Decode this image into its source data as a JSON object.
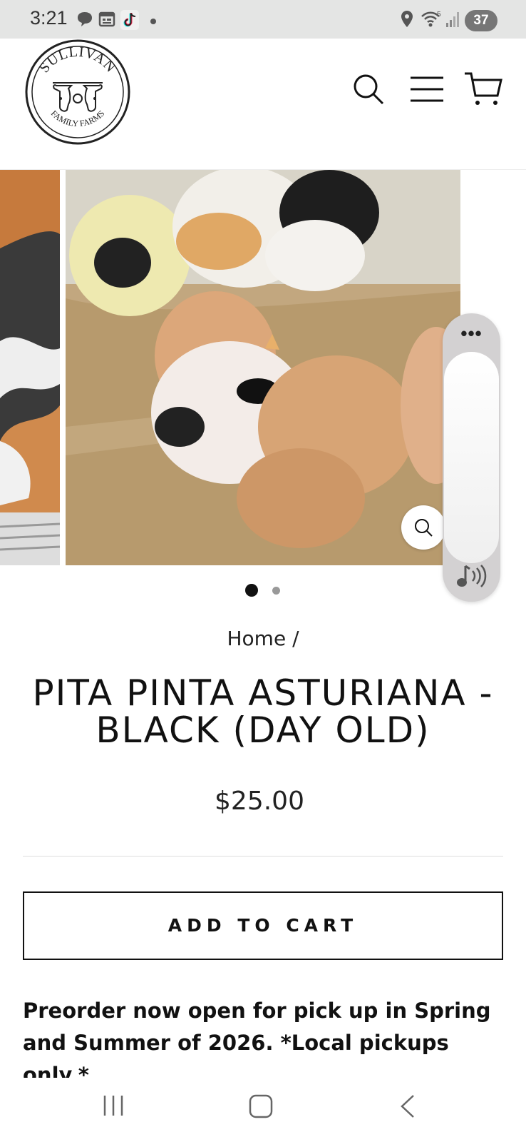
{
  "status_bar": {
    "time": "3:21",
    "battery": "37",
    "network": "5",
    "icons": [
      "chat-icon",
      "calendar-icon",
      "tiktok-icon",
      "dot-icon",
      "location-icon",
      "wifi-icon",
      "signal-icon"
    ]
  },
  "header": {
    "logo_text": "SULLIVAN",
    "logo_subtext": "FAMILY FARMS",
    "icons": [
      "search-icon",
      "menu-icon",
      "cart-icon"
    ]
  },
  "gallery": {
    "current_index": 1,
    "total": 2
  },
  "side_panel": {
    "more": "•••",
    "icons": [
      "more-icon",
      "sound-icon"
    ]
  },
  "product": {
    "breadcrumb": "Home /",
    "title": "PITA PINTA ASTURIANA - BLACK (DAY OLD)",
    "price": "$25.00",
    "add_to_cart": "ADD TO CART",
    "description": "Preorder now open for pick up in Spring and Summer of 2026. *Local pickups only.*"
  },
  "nav_bar": {
    "icons": [
      "recents-icon",
      "home-icon",
      "back-icon"
    ]
  },
  "colors": {
    "status_bg": "#e4e5e4",
    "text": "#111111",
    "dot_active": "#111111",
    "dot_inactive": "#999999"
  }
}
